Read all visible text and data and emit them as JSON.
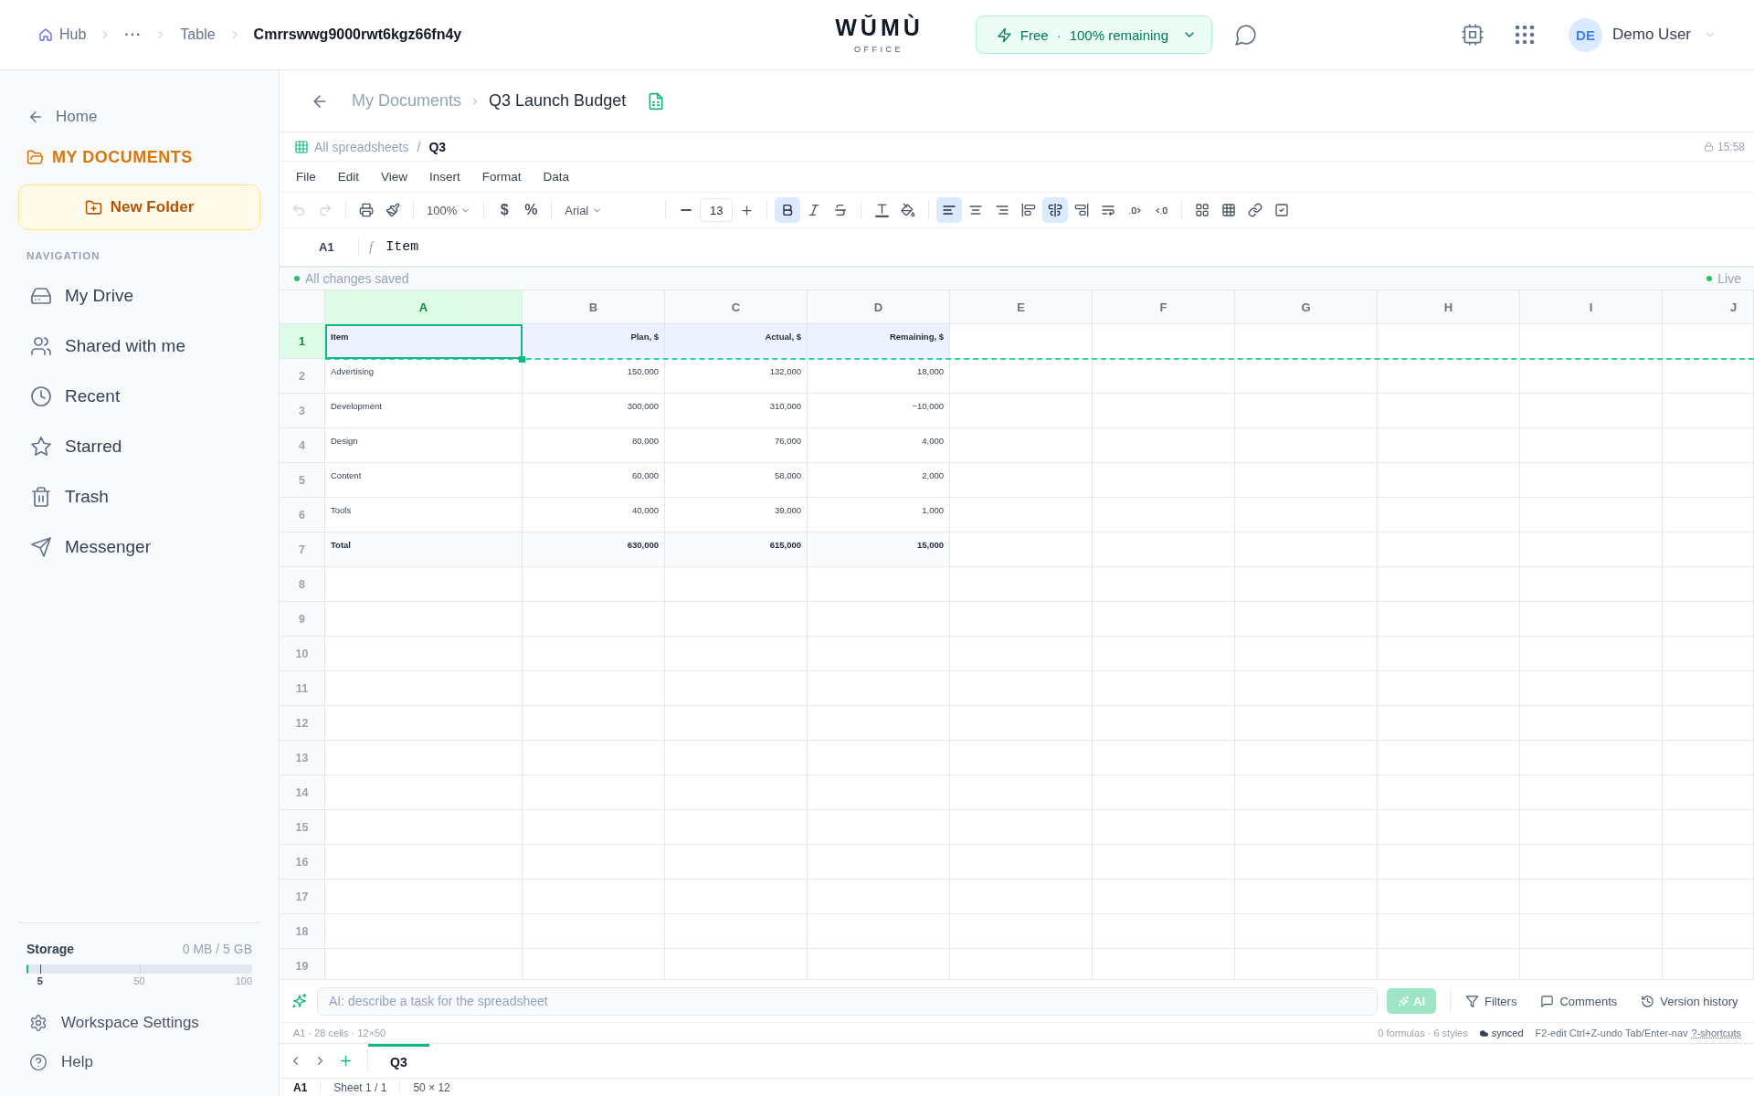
{
  "top_bar": {
    "breadcrumb": [
      {
        "label": "Hub",
        "kind": "home"
      },
      {
        "label": "···",
        "kind": "more"
      },
      {
        "label": "Table",
        "kind": "link"
      },
      {
        "label": "Cmrrswwg9000rwt6kgz66fn4y",
        "kind": "current"
      }
    ],
    "logo": {
      "wordmark": "WŬMÙ",
      "tagline": "OFFICE"
    },
    "plan": {
      "name": "Free",
      "separator": "·",
      "remaining": "100% remaining"
    },
    "user": {
      "initials": "DE",
      "name": "Demo User"
    }
  },
  "sidebar": {
    "back": "Home",
    "section": "MY DOCUMENTS",
    "new_folder": "New Folder",
    "nav_heading": "NAVIGATION",
    "nav": [
      "My Drive",
      "Shared with me",
      "Recent",
      "Starred",
      "Trash",
      "Messenger"
    ],
    "storage": {
      "label": "Storage",
      "usage": "0 MB / 5 GB",
      "level": 0.01,
      "ticks": [
        "5",
        "50",
        "100"
      ]
    },
    "footer": [
      "Workspace Settings",
      "Help"
    ]
  },
  "doc_header": {
    "breadcrumb": [
      "My Documents",
      "Q3 Launch Budget"
    ]
  },
  "sheet_path": {
    "root": "All spreadsheets",
    "separator": "/",
    "current": "Q3",
    "time": "15:58"
  },
  "menu": [
    "File",
    "Edit",
    "View",
    "Insert",
    "Format",
    "Data"
  ],
  "toolbar": {
    "undo": {
      "disabled": true
    },
    "redo": {
      "disabled": true
    },
    "zoom": "100%",
    "currency": "$",
    "percent": "%",
    "font": "Arial",
    "font_size": "13",
    "text_styles": [
      {
        "on": true
      },
      {
        "on": false
      },
      {
        "on": false
      }
    ],
    "horizontal_align": [
      {
        "selected": true
      },
      {
        "selected": false
      },
      {
        "selected": false
      }
    ],
    "block_align": [
      {
        "selected": false
      },
      {
        "selected": true
      },
      {
        "selected": false
      }
    ]
  },
  "formula_bar": {
    "cell": "A1",
    "fx": "f",
    "value": "Item"
  },
  "save_status": {
    "text": "All changes saved",
    "live": "Live"
  },
  "grid": {
    "columns": [
      {
        "label": "A",
        "selected": true
      },
      {
        "label": "B",
        "selected": false
      },
      {
        "label": "C",
        "selected": false
      },
      {
        "label": "D",
        "selected": false
      },
      {
        "label": "E",
        "selected": false
      },
      {
        "label": "F",
        "selected": false
      },
      {
        "label": "G",
        "selected": false
      },
      {
        "label": "H",
        "selected": false
      },
      {
        "label": "I",
        "selected": false
      },
      {
        "label": "J",
        "selected": false
      }
    ],
    "rows": [
      {
        "number": "1",
        "selected": true,
        "frozen": true,
        "kind": "header",
        "cells": [
          {
            "text": "Item",
            "selected": true
          },
          {
            "text": "Plan, $",
            "selected": false
          },
          {
            "text": "Actual, $",
            "selected": false
          },
          {
            "text": "Remaining, $",
            "selected": false
          }
        ]
      },
      {
        "number": "2",
        "selected": false,
        "frozen": false,
        "kind": "data",
        "cells": [
          {
            "text": "Advertising",
            "selected": false
          },
          {
            "text": "150,000",
            "selected": false
          },
          {
            "text": "132,000",
            "selected": false
          },
          {
            "text": "18,000",
            "selected": false
          }
        ]
      },
      {
        "number": "3",
        "selected": false,
        "frozen": false,
        "kind": "data",
        "cells": [
          {
            "text": "Development",
            "selected": false
          },
          {
            "text": "300,000",
            "selected": false
          },
          {
            "text": "310,000",
            "selected": false
          },
          {
            "text": "−10,000",
            "selected": false
          }
        ]
      },
      {
        "number": "4",
        "selected": false,
        "frozen": false,
        "kind": "data",
        "cells": [
          {
            "text": "Design",
            "selected": false
          },
          {
            "text": "80,000",
            "selected": false
          },
          {
            "text": "76,000",
            "selected": false
          },
          {
            "text": "4,000",
            "selected": false
          }
        ]
      },
      {
        "number": "5",
        "selected": false,
        "frozen": false,
        "kind": "data",
        "cells": [
          {
            "text": "Content",
            "selected": false
          },
          {
            "text": "60,000",
            "selected": false
          },
          {
            "text": "58,000",
            "selected": false
          },
          {
            "text": "2,000",
            "selected": false
          }
        ]
      },
      {
        "number": "6",
        "selected": false,
        "frozen": false,
        "kind": "data",
        "cells": [
          {
            "text": "Tools",
            "selected": false
          },
          {
            "text": "40,000",
            "selected": false
          },
          {
            "text": "39,000",
            "selected": false
          },
          {
            "text": "1,000",
            "selected": false
          }
        ]
      },
      {
        "number": "7",
        "selected": false,
        "frozen": false,
        "kind": "total",
        "cells": [
          {
            "text": "Total",
            "selected": false
          },
          {
            "text": "630,000",
            "selected": false
          },
          {
            "text": "615,000",
            "selected": false
          },
          {
            "text": "15,000",
            "selected": false
          }
        ]
      },
      {
        "number": "8",
        "selected": false,
        "frozen": false
      },
      {
        "number": "9",
        "selected": false,
        "frozen": false
      },
      {
        "number": "10",
        "selected": false,
        "frozen": false
      },
      {
        "number": "11",
        "selected": false,
        "frozen": false
      },
      {
        "number": "12",
        "selected": false,
        "frozen": false
      },
      {
        "number": "13",
        "selected": false,
        "frozen": false
      },
      {
        "number": "14",
        "selected": false,
        "frozen": false
      },
      {
        "number": "15",
        "selected": false,
        "frozen": false
      },
      {
        "number": "16",
        "selected": false,
        "frozen": false
      },
      {
        "number": "17",
        "selected": false,
        "frozen": false
      },
      {
        "number": "18",
        "selected": false,
        "frozen": false
      },
      {
        "number": "19",
        "selected": false,
        "frozen": false
      }
    ]
  },
  "ai_bar": {
    "placeholder": "AI: describe a task for the spreadsheet",
    "button": "AI",
    "button_disabled": true,
    "actions": [
      "Filters",
      "Comments",
      "Version history"
    ]
  },
  "info_bar": {
    "selection": "A1 · 28 cells · 12×50",
    "stats": "0 formulas · 6 styles",
    "sync": "synced",
    "shortcuts": "F2-edit Ctrl+Z-undo Tab/Enter-nav",
    "shortcuts_link": "?-shortcuts"
  },
  "sheet_tabs": [
    {
      "label": "Q3",
      "selected": true
    }
  ],
  "status_bar": {
    "cell": "A1",
    "sheet": "Sheet 1 / 1",
    "size": "50 × 12"
  }
}
